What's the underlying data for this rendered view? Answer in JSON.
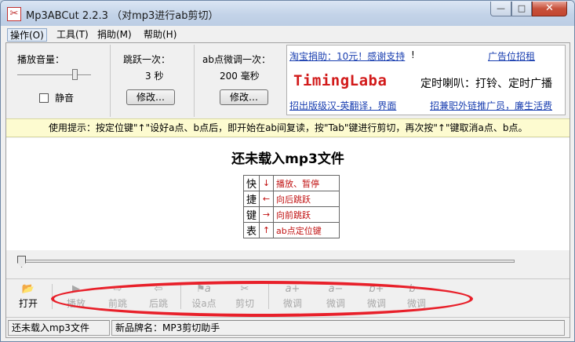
{
  "window": {
    "title": "Mp3ABCut 2.2.3 （对mp3进行ab剪切）",
    "icon": "scissors-icon",
    "controls": {
      "minimize": "—",
      "maximize": "□",
      "close": "✕"
    }
  },
  "menu": [
    {
      "label": "操作(O)",
      "active": true
    },
    {
      "label": "工具(T)"
    },
    {
      "label": "捐助(M)"
    },
    {
      "label": "帮助(H)"
    }
  ],
  "volume": {
    "label": "播放音量：",
    "mute_label": "静音",
    "muted": false,
    "level": 0.8
  },
  "jump": {
    "label": "跳跃一次：",
    "value": "3  秒",
    "button": "修改…"
  },
  "fine": {
    "label": "ab点微调一次：",
    "value": "200  毫秒",
    "button": "修改…"
  },
  "ad": {
    "donate_link": "淘宝捐助：10元！感谢支持",
    "donate_suffix": "!",
    "ad_link": "广告位招租",
    "logo": "TimingLaba",
    "slogan": "定时喇叭：打铃、定时广播",
    "left_link": "招出版级汉-英翻译，界面",
    "right_link": "招兼职外链推广员，廉生活费"
  },
  "tip": "使用提示：按定位键\"↑\"设好a点、b点后，即开始在ab间复读，按\"Tab\"键进行剪切，再次按\"↑\"键取消a点、b点。",
  "main": {
    "status": "还未载入mp3文件",
    "shortcuts_title": [
      "快",
      "捷",
      "键",
      "表"
    ],
    "shortcuts": [
      {
        "key": "↓",
        "action": "播放、暂停"
      },
      {
        "key": "←",
        "action": "向后跳跃"
      },
      {
        "key": "→",
        "action": "向前跳跃"
      },
      {
        "key": "↑",
        "action": "ab点定位键"
      }
    ]
  },
  "seek": {
    "position": 0
  },
  "toolbar": [
    {
      "name": "open",
      "label": "打开",
      "icon": "folder-open-icon",
      "glyph": "📂",
      "enabled": true
    },
    {
      "name": "play",
      "label": "播放",
      "icon": "play-icon",
      "glyph": "▶",
      "enabled": false
    },
    {
      "name": "forward",
      "label": "前跳",
      "icon": "arrow-right-icon",
      "glyph": "⇨",
      "enabled": false
    },
    {
      "name": "back",
      "label": "后跳",
      "icon": "arrow-left-icon",
      "glyph": "⇦",
      "enabled": false
    },
    {
      "name": "set-a",
      "label": "设a点",
      "icon": "flag-a-icon",
      "glyph": "⚑a",
      "enabled": false
    },
    {
      "name": "cut",
      "label": "剪切",
      "icon": "scissors-icon",
      "glyph": "✂",
      "enabled": false
    },
    {
      "name": "a-plus",
      "label": "微调",
      "icon": "a-plus-icon",
      "glyph": "a+",
      "enabled": false
    },
    {
      "name": "a-minus",
      "label": "微调",
      "icon": "a-minus-icon",
      "glyph": "a−",
      "enabled": false
    },
    {
      "name": "b-plus",
      "label": "微调",
      "icon": "b-plus-icon",
      "glyph": "b+",
      "enabled": false
    },
    {
      "name": "b-minus",
      "label": "微调",
      "icon": "b-minus-icon",
      "glyph": "b−",
      "enabled": false
    }
  ],
  "statusbar": {
    "left": "还未载入mp3文件",
    "right": "新品牌名：MP3剪切助手"
  },
  "colors": {
    "accent_red": "#e8202a",
    "link": "#1a3fb0",
    "tip_bg": "#fdfbd0"
  }
}
